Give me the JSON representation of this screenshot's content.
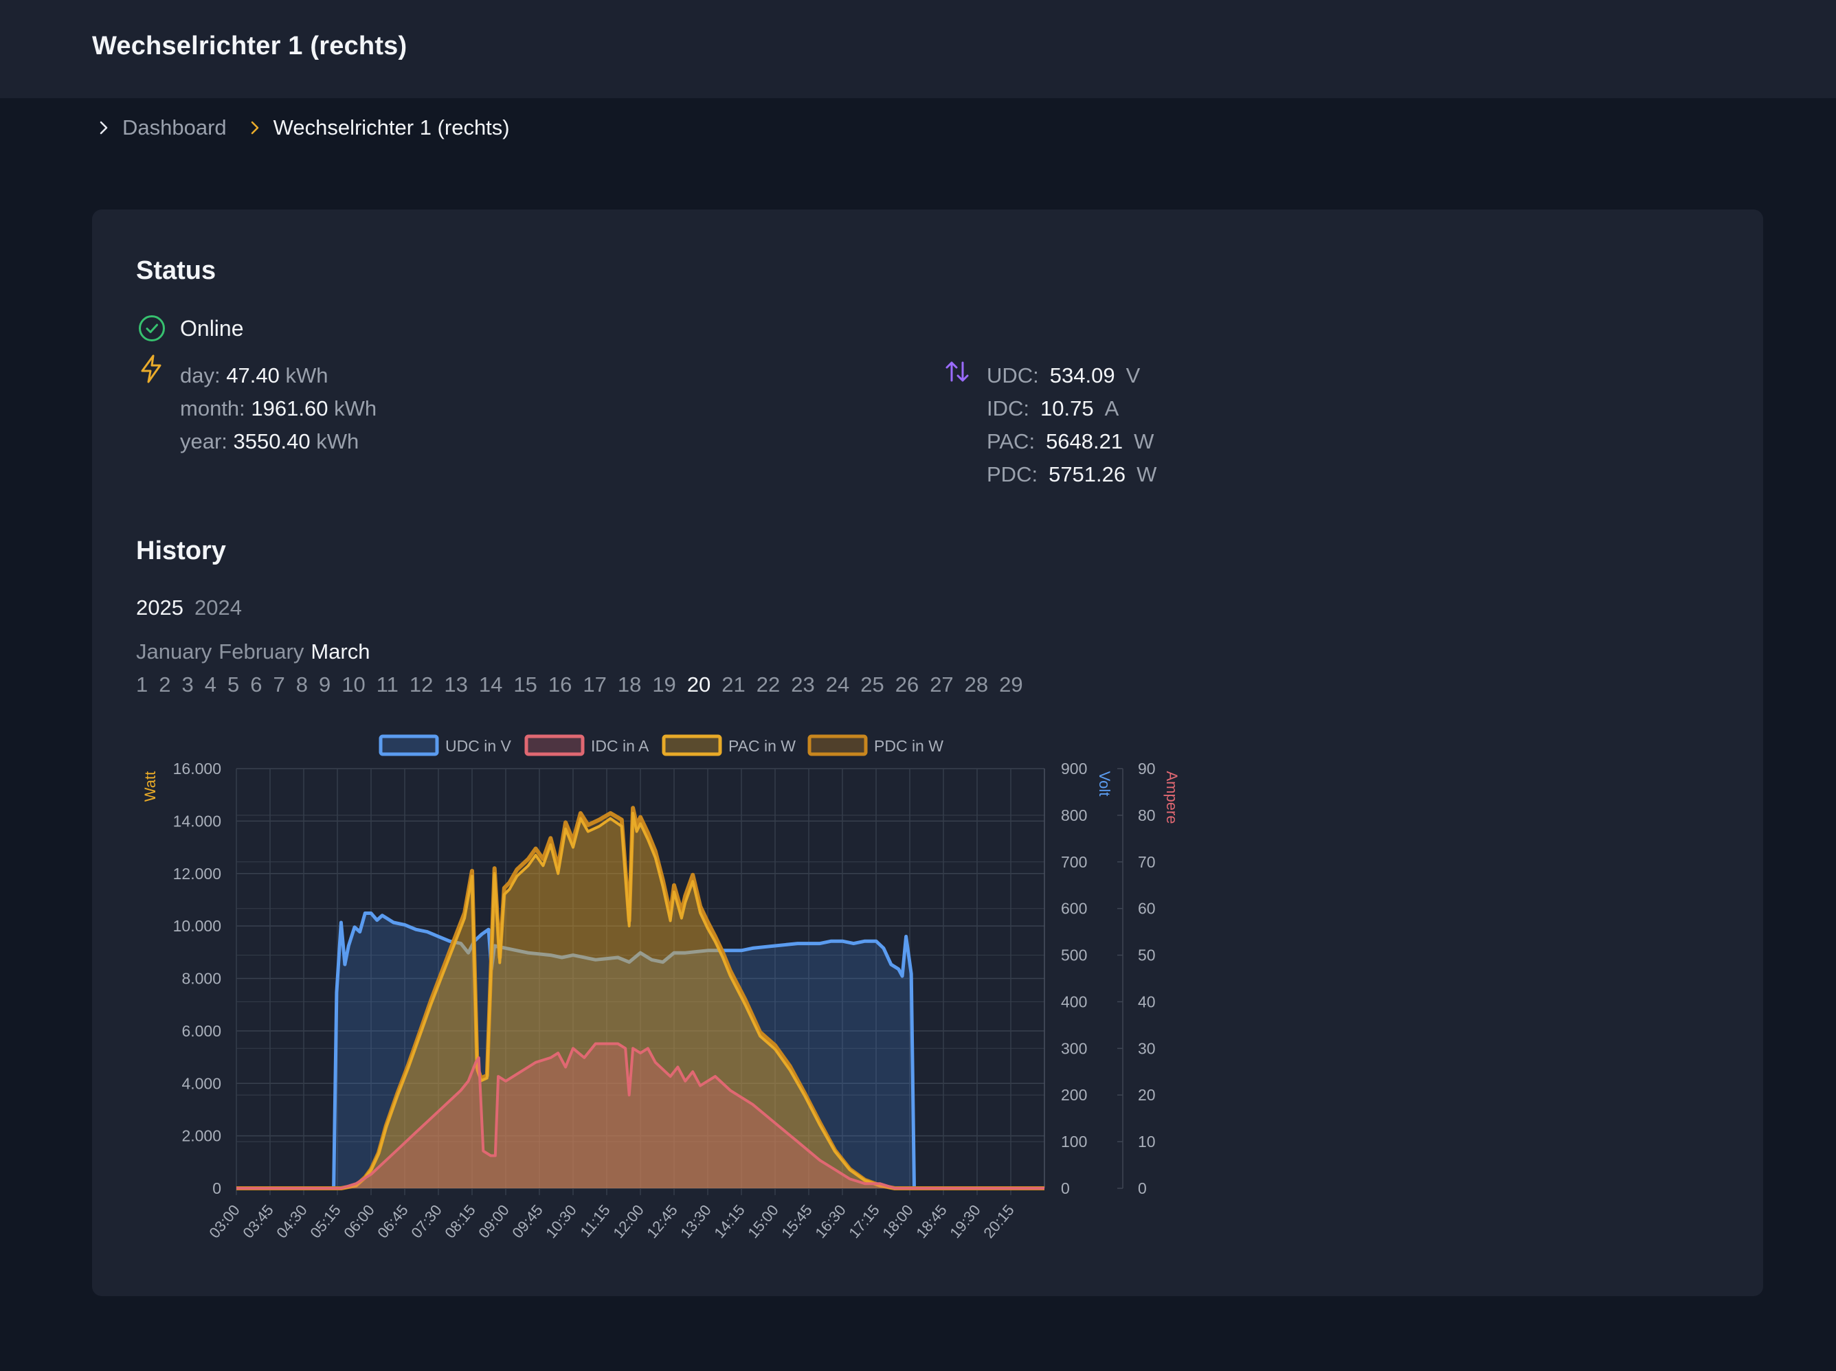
{
  "header": {
    "title": "Wechselrichter 1 (rechts)"
  },
  "breadcrumb": {
    "items": [
      "Dashboard",
      "Wechselrichter 1 (rechts)"
    ]
  },
  "status": {
    "title": "Status",
    "state": "Online",
    "energy": {
      "day": {
        "label": "day:",
        "value": "47.40",
        "unit": "kWh"
      },
      "month": {
        "label": "month:",
        "value": "1961.60",
        "unit": "kWh"
      },
      "year": {
        "label": "year:",
        "value": "3550.40",
        "unit": "kWh"
      }
    },
    "dc": {
      "udc": {
        "label": "UDC:",
        "value": "534.09",
        "unit": "V"
      },
      "idc": {
        "label": "IDC:",
        "value": "10.75",
        "unit": "A"
      },
      "pac": {
        "label": "PAC:",
        "value": "5648.21",
        "unit": "W"
      },
      "pdc": {
        "label": "PDC:",
        "value": "5751.26",
        "unit": "W"
      }
    }
  },
  "history": {
    "title": "History",
    "years": [
      "2025",
      "2024"
    ],
    "selected_year": "2025",
    "months": [
      "January",
      "February",
      "March"
    ],
    "selected_month": "March",
    "days": [
      "1",
      "2",
      "3",
      "4",
      "5",
      "6",
      "7",
      "8",
      "9",
      "10",
      "11",
      "12",
      "13",
      "14",
      "15",
      "16",
      "17",
      "18",
      "19",
      "20",
      "21",
      "22",
      "23",
      "24",
      "25",
      "26",
      "27",
      "28",
      "29"
    ],
    "selected_day": "20"
  },
  "colors": {
    "udc": "#5b9cf0",
    "idc": "#e06872",
    "pac": "#e8aa28",
    "pdc": "#c8861e",
    "online": "#37c16f",
    "bolt": "#e9ab2b",
    "swap": "#9b6bff"
  },
  "chart_data": {
    "type": "line",
    "legend": [
      "UDC in V",
      "IDC in A",
      "PAC in W",
      "PDC in W"
    ],
    "legend_position": "top",
    "grid": true,
    "axes": {
      "y_left": {
        "label": "Watt",
        "range": [
          0,
          16000
        ],
        "ticks": [
          "0",
          "2.000",
          "4.000",
          "6.000",
          "8.000",
          "10.000",
          "12.000",
          "14.000",
          "16.000"
        ]
      },
      "y_volt": {
        "label": "Volt",
        "range": [
          0,
          900
        ],
        "ticks": [
          "0",
          "100",
          "200",
          "300",
          "400",
          "500",
          "600",
          "700",
          "800",
          "900"
        ]
      },
      "y_amp": {
        "label": "Ampere",
        "range": [
          0,
          90
        ],
        "ticks": [
          "0",
          "10",
          "20",
          "30",
          "40",
          "50",
          "60",
          "70",
          "80",
          "90"
        ]
      },
      "x": {
        "range": [
          "03:00",
          "21:00"
        ],
        "ticks": [
          "03:00",
          "03:45",
          "04:30",
          "05:15",
          "06:00",
          "06:45",
          "07:30",
          "08:15",
          "09:00",
          "09:45",
          "10:30",
          "11:15",
          "12:00",
          "12:45",
          "13:30",
          "14:15",
          "15:00",
          "15:45",
          "16:30",
          "17:15",
          "18:00",
          "18:45",
          "19:30",
          "20:15"
        ]
      }
    },
    "series": [
      {
        "name": "UDC in V",
        "axis": "y_volt",
        "x": [
          "03:00",
          "05:10",
          "05:14",
          "05:20",
          "05:25",
          "05:30",
          "05:38",
          "05:45",
          "05:52",
          "06:00",
          "06:08",
          "06:15",
          "06:30",
          "06:45",
          "07:00",
          "07:15",
          "07:30",
          "07:45",
          "08:00",
          "08:10",
          "08:18",
          "08:28",
          "08:37",
          "08:41",
          "08:45",
          "09:00",
          "09:30",
          "10:00",
          "10:15",
          "10:30",
          "11:00",
          "11:30",
          "11:45",
          "12:00",
          "12:15",
          "12:30",
          "12:45",
          "13:00",
          "13:30",
          "14:00",
          "14:15",
          "14:30",
          "15:00",
          "15:30",
          "16:00",
          "16:15",
          "16:30",
          "16:45",
          "17:00",
          "17:15",
          "17:25",
          "17:35",
          "17:45",
          "17:50",
          "17:55",
          "18:02",
          "18:06",
          "18:10",
          "21:00"
        ],
        "values": [
          0,
          0,
          420,
          570,
          480,
          520,
          560,
          550,
          590,
          590,
          575,
          585,
          570,
          565,
          555,
          550,
          540,
          530,
          525,
          505,
          530,
          545,
          555,
          470,
          520,
          515,
          505,
          500,
          495,
          500,
          490,
          495,
          485,
          505,
          490,
          485,
          505,
          505,
          510,
          510,
          510,
          515,
          520,
          525,
          525,
          530,
          530,
          525,
          530,
          530,
          515,
          480,
          470,
          455,
          540,
          460,
          0,
          0,
          0
        ]
      },
      {
        "name": "IDC in A",
        "axis": "y_amp",
        "x": [
          "03:00",
          "05:20",
          "05:40",
          "06:00",
          "06:20",
          "06:40",
          "07:00",
          "07:20",
          "07:40",
          "08:00",
          "08:10",
          "08:20",
          "08:24",
          "08:30",
          "08:40",
          "08:46",
          "08:50",
          "09:00",
          "09:20",
          "09:40",
          "10:00",
          "10:10",
          "10:20",
          "10:30",
          "10:45",
          "11:00",
          "11:30",
          "11:40",
          "11:45",
          "11:50",
          "12:00",
          "12:10",
          "12:20",
          "12:40",
          "12:50",
          "13:00",
          "13:10",
          "13:20",
          "13:40",
          "14:00",
          "14:30",
          "15:00",
          "15:30",
          "16:00",
          "16:20",
          "16:40",
          "17:00",
          "17:20",
          "17:40",
          "17:55",
          "21:00"
        ],
        "values": [
          0,
          0,
          1,
          3,
          6,
          9,
          12,
          15,
          18,
          21,
          23,
          27,
          28,
          8,
          7,
          7,
          24,
          23,
          25,
          27,
          28,
          29,
          26,
          30,
          28,
          31,
          31,
          30,
          20,
          30,
          29,
          30,
          27,
          24,
          26,
          23,
          25,
          22,
          24,
          21,
          18,
          14,
          10,
          6,
          4,
          2,
          1,
          1,
          0,
          0,
          0
        ]
      },
      {
        "name": "PAC in W",
        "axis": "y_left",
        "x": [
          "03:00",
          "05:20",
          "05:40",
          "05:52",
          "06:00",
          "06:10",
          "06:20",
          "06:35",
          "06:50",
          "07:05",
          "07:20",
          "07:35",
          "07:50",
          "08:05",
          "08:15",
          "08:22",
          "08:27",
          "08:35",
          "08:45",
          "08:52",
          "08:58",
          "09:05",
          "09:15",
          "09:30",
          "09:40",
          "09:50",
          "10:00",
          "10:10",
          "10:20",
          "10:30",
          "10:40",
          "10:50",
          "11:05",
          "11:20",
          "11:35",
          "11:45",
          "11:50",
          "11:55",
          "12:00",
          "12:10",
          "12:20",
          "12:30",
          "12:40",
          "12:45",
          "12:55",
          "13:00",
          "13:10",
          "13:20",
          "13:30",
          "13:40",
          "13:50",
          "14:00",
          "14:20",
          "14:40",
          "15:00",
          "15:20",
          "15:40",
          "16:00",
          "16:20",
          "16:40",
          "17:00",
          "17:20",
          "17:40",
          "17:55",
          "21:00"
        ],
        "values": [
          0,
          0,
          100,
          400,
          700,
          1300,
          2300,
          3500,
          4600,
          5800,
          7000,
          8100,
          9200,
          10300,
          11900,
          4500,
          4100,
          4200,
          12000,
          8600,
          11200,
          11400,
          11900,
          12300,
          12700,
          12300,
          13100,
          12000,
          13700,
          13000,
          14100,
          13600,
          13800,
          14100,
          13800,
          10000,
          14300,
          13600,
          13900,
          13300,
          12600,
          11500,
          10200,
          11300,
          10300,
          10900,
          11700,
          10500,
          9900,
          9400,
          8800,
          8100,
          7000,
          5800,
          5300,
          4500,
          3500,
          2400,
          1400,
          700,
          300,
          100,
          0,
          0,
          0
        ]
      },
      {
        "name": "PDC in W",
        "axis": "y_left",
        "x": [
          "03:00",
          "05:20",
          "05:40",
          "05:52",
          "06:00",
          "06:10",
          "06:20",
          "06:35",
          "06:50",
          "07:05",
          "07:20",
          "07:35",
          "07:50",
          "08:05",
          "08:15",
          "08:22",
          "08:27",
          "08:35",
          "08:45",
          "08:52",
          "08:58",
          "09:05",
          "09:15",
          "09:30",
          "09:40",
          "09:50",
          "10:00",
          "10:10",
          "10:20",
          "10:30",
          "10:40",
          "10:50",
          "11:05",
          "11:20",
          "11:35",
          "11:45",
          "11:50",
          "11:55",
          "12:00",
          "12:10",
          "12:20",
          "12:30",
          "12:40",
          "12:45",
          "12:55",
          "13:00",
          "13:10",
          "13:20",
          "13:30",
          "13:40",
          "13:50",
          "14:00",
          "14:20",
          "14:40",
          "15:00",
          "15:20",
          "15:40",
          "16:00",
          "16:20",
          "16:40",
          "17:00",
          "17:20",
          "17:40",
          "17:55",
          "21:00"
        ],
        "values": [
          0,
          0,
          110,
          420,
          730,
          1350,
          2380,
          3600,
          4720,
          5940,
          7160,
          8280,
          9400,
          10500,
          12100,
          4600,
          4200,
          4300,
          12200,
          8800,
          11450,
          11650,
          12150,
          12550,
          12950,
          12550,
          13350,
          12250,
          13950,
          13250,
          14300,
          13850,
          14050,
          14300,
          14050,
          10200,
          14500,
          13850,
          14150,
          13550,
          12850,
          11750,
          10450,
          11550,
          10550,
          11150,
          11950,
          10750,
          10150,
          9600,
          9000,
          8300,
          7200,
          5950,
          5450,
          4650,
          3600,
          2500,
          1450,
          730,
          320,
          110,
          0,
          0,
          0
        ]
      }
    ]
  }
}
